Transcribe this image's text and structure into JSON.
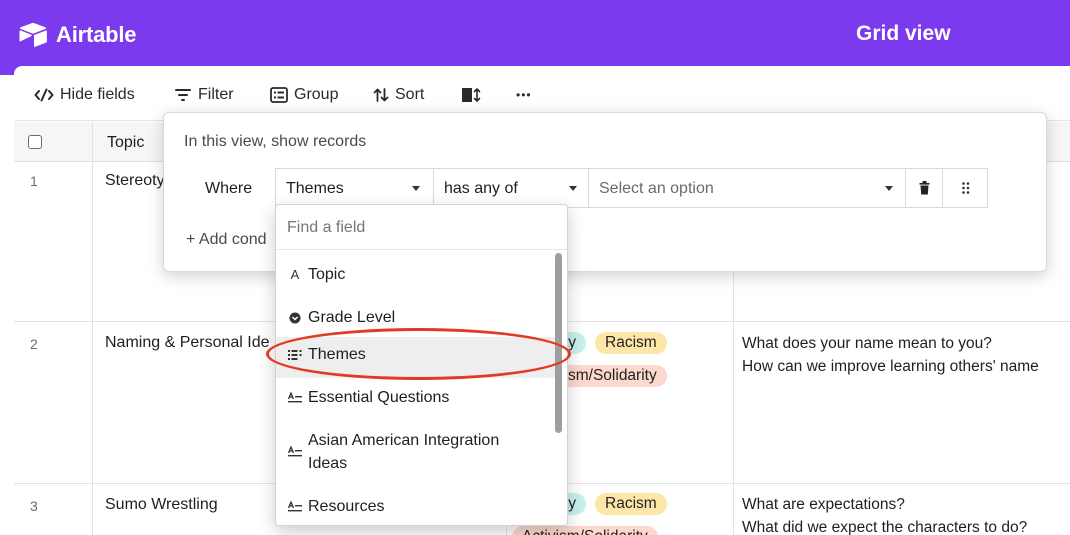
{
  "app": {
    "name": "Airtable",
    "view_title": "Grid view"
  },
  "colors": {
    "brand": "#7b3aee",
    "annotation": "#e23a25"
  },
  "toolbar": {
    "hide_fields": "Hide fields",
    "filter": "Filter",
    "group": "Group",
    "sort": "Sort",
    "more": "•••"
  },
  "grid": {
    "columns": {
      "topic": "Topic"
    },
    "rows": [
      {
        "num": "1",
        "topic": "Stereoty",
        "themes": [],
        "questions": []
      },
      {
        "num": "2",
        "topic": "Naming & Personal Ide",
        "themes": [
          "ty",
          "Racism",
          "sm/Solidarity"
        ],
        "questions": [
          "What does your name mean to you?",
          "How can we improve learning others' name"
        ]
      },
      {
        "num": "3",
        "topic": "Sumo Wrestling",
        "themes": [
          "ty",
          "Racism",
          "Activism/Solidarity"
        ],
        "questions": [
          "What are expectations?",
          "What did we expect the characters to do?"
        ]
      }
    ]
  },
  "filter_popover": {
    "heading": "In this view, show records",
    "where": "Where",
    "field": "Themes",
    "operator": "has any of",
    "value_placeholder": "Select an option",
    "add_condition": "+ Add cond"
  },
  "field_dropdown": {
    "search_placeholder": "Find a field",
    "items": [
      {
        "label": "Topic",
        "icon": "text-A-icon"
      },
      {
        "label": "Grade Level",
        "icon": "single-select-icon"
      },
      {
        "label": "Themes",
        "icon": "multi-select-icon",
        "highlighted": true
      },
      {
        "label": "Essential Questions",
        "icon": "long-text-icon"
      },
      {
        "label": "Asian American Integration Ideas",
        "icon": "long-text-icon"
      },
      {
        "label": "Resources",
        "icon": "long-text-icon"
      }
    ]
  }
}
